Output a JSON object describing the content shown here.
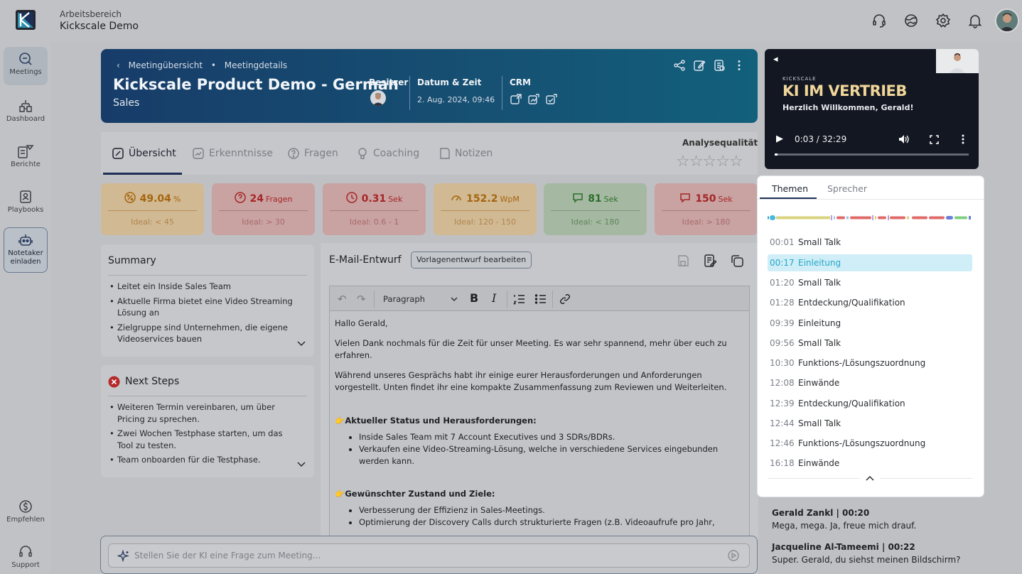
{
  "app": {
    "workspace_label": "Arbeitsbereich",
    "workspace_name": "Kickscale Demo"
  },
  "topbar": {
    "icons": [
      "headset-icon",
      "globe-icon",
      "gear-icon",
      "bell-icon"
    ],
    "avatar": "user-avatar"
  },
  "sidebar": {
    "items": [
      {
        "label": "Meetings",
        "icon": "meetings-icon",
        "active": true
      },
      {
        "label": "Dashboard",
        "icon": "dashboard-icon"
      },
      {
        "label": "Berichte",
        "icon": "reports-icon"
      },
      {
        "label": "Playbooks",
        "icon": "playbooks-icon"
      },
      {
        "label": "Notetaker einladen",
        "icon": "robot-icon"
      }
    ],
    "bottom": [
      {
        "label": "Empfehlen",
        "icon": "refer-icon"
      },
      {
        "label": "Support",
        "icon": "support-icon"
      }
    ]
  },
  "header": {
    "breadcrumb": [
      "Meetingübersicht",
      "Meetingdetails"
    ],
    "title": "Kickscale Product Demo - German",
    "subtitle": "Sales",
    "owner_label": "Besitzer",
    "datetime_label": "Datum & Zeit",
    "datetime_value": "2. Aug. 2024, 09:46",
    "crm_label": "CRM",
    "actions": [
      "share-icon",
      "edit-icon",
      "document-icon",
      "more-vertical-icon"
    ]
  },
  "tabs": [
    {
      "label": "Übersicht",
      "active": true
    },
    {
      "label": "Erkenntnisse"
    },
    {
      "label": "Fragen"
    },
    {
      "label": "Coaching"
    },
    {
      "label": "Notizen"
    }
  ],
  "analysis_quality": {
    "label": "Analysequalität",
    "rating": 0,
    "max": 5
  },
  "metrics": [
    {
      "value": "49.04",
      "unit": "%",
      "ideal": "Ideal: < 45",
      "tone": "orange"
    },
    {
      "value": "24",
      "unit": "Fragen",
      "ideal": "Ideal: > 30",
      "tone": "red"
    },
    {
      "value": "0.31",
      "unit": "Sek",
      "ideal": "Ideal: 0.6 - 1",
      "tone": "red"
    },
    {
      "value": "152.2",
      "unit": "WpM",
      "ideal": "Ideal: 120 - 150",
      "tone": "orange"
    },
    {
      "value": "81",
      "unit": "Sek",
      "ideal": "Ideal: < 180",
      "tone": "green"
    },
    {
      "value": "150",
      "unit": "Sek",
      "ideal": "Ideal: > 180",
      "tone": "red"
    }
  ],
  "summary": {
    "title": "Summary",
    "items": [
      "Leitet ein Inside Sales Team",
      "Aktuelle Firma bietet eine Video Streaming Lösung an",
      "Zielgruppe sind Unternehmen, die eigene Videoservices bauen"
    ]
  },
  "next_steps": {
    "title": "Next Steps",
    "items": [
      "Weiteren Termin vereinbaren, um über Pricing zu sprechen.",
      "Zwei Wochen Testphase starten, um das Tool zu testen.",
      "Team onboarden für die Testphase."
    ]
  },
  "email": {
    "title": "E-Mail-Entwurf",
    "template_button": "Vorlagenentwurf bearbeiten",
    "toolbar": {
      "block_style": "Paragraph"
    },
    "body": {
      "greeting": "Hallo Gerald,",
      "p1": "Vielen Dank nochmals für die Zeit für unser Meeting. Es war sehr spannend, mehr über euch zu erfahren.",
      "p2": "Während unseres Gesprächs habt ihr einige eurer Herausforderungen und Anforderungen vorgestellt. Unten findet ihr eine kompakte Zusammenfassung zum Reviewen und Weiterleiten.",
      "h1": "Aktueller Status und Herausforderungen:",
      "h1_items": [
        "Inside Sales Team mit 7 Account Executives und 3 SDRs/BDRs.",
        "Verkaufen eine Video-Streaming-Lösung, welche in verschiedene Services eingebunden werden kann."
      ],
      "h2": "Gewünschter Zustand und Ziele:",
      "h2_items": [
        "Verbesserung der Effizienz in Sales-Meetings.",
        "Optimierung der Discovery Calls durch strukturierte Fragen (z.B. Videoaufrufe pro Jahr,"
      ]
    }
  },
  "ask": {
    "placeholder": "Stellen Sie der KI eine Frage zum Meeting..."
  },
  "video": {
    "brand": "KICKSCALE",
    "headline": "KI IM VERTRIEB",
    "subline": "Herzlich Willkommen, Gerald!",
    "time": "0:03 / 32:29",
    "progress": 0.0015
  },
  "topics": {
    "tabs": [
      {
        "label": "Themen",
        "active": true
      },
      {
        "label": "Sprecher"
      }
    ],
    "rows": [
      {
        "time": "00:01",
        "label": "Small Talk"
      },
      {
        "time": "00:17",
        "label": "Einleitung",
        "selected": true
      },
      {
        "time": "01:20",
        "label": "Small Talk"
      },
      {
        "time": "01:28",
        "label": "Entdeckung/Qualifikation"
      },
      {
        "time": "09:39",
        "label": "Einleitung"
      },
      {
        "time": "09:56",
        "label": "Small Talk"
      },
      {
        "time": "10:30",
        "label": "Funktions-/Lösungszuordnung"
      },
      {
        "time": "12:08",
        "label": "Einwände"
      },
      {
        "time": "12:39",
        "label": "Entdeckung/Qualifikation"
      },
      {
        "time": "12:44",
        "label": "Small Talk"
      },
      {
        "time": "12:46",
        "label": "Funktions-/Lösungszuordnung"
      },
      {
        "time": "16:18",
        "label": "Einwände"
      }
    ]
  },
  "transcript": [
    {
      "speaker": "Gerald Zankl | 00:20",
      "text": "Mega, mega. Ja, freue mich drauf."
    },
    {
      "speaker": "Jacqueline Al-Tameemi | 00:22",
      "text": "Super. Gerald, du siehst meinen Bildschirm?"
    }
  ],
  "colors": {
    "accent": "#1d2f56",
    "teal": "#26a7c8",
    "orange_bg": "#d1b993",
    "red_bg": "#c9a2a2",
    "green_bg": "#a5b9a2"
  }
}
